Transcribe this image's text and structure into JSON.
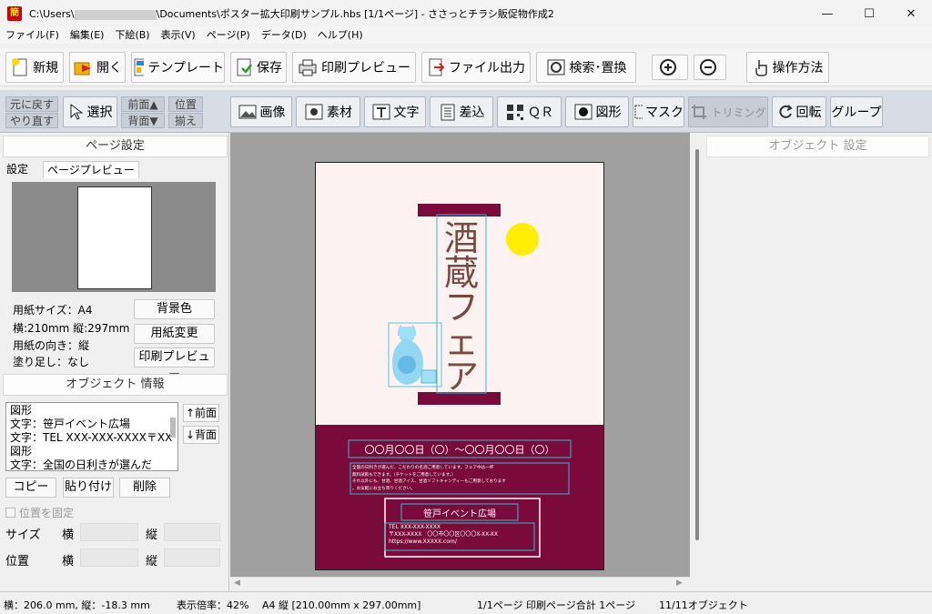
{
  "window": {
    "title_prefix": "C:\\Users\\",
    "title_suffix": "\\Documents\\ポスター拡大印刷サンプル.hbs  [1/1ページ] - ささっとチラシ販促物作成2",
    "app_icon_text": "簡"
  },
  "menu": [
    "ファイル(F)",
    "編集(E)",
    "下絵(B)",
    "表示(V)",
    "ページ(P)",
    "データ(D)",
    "ヘルプ(H)"
  ],
  "toolbar": {
    "new": "新規",
    "open": "開く",
    "template": "テンプレート",
    "save": "保存",
    "print_preview": "印刷プレビュー",
    "file_output": "ファイル出力",
    "search_replace": "検索･置換",
    "how_to": "操作方法"
  },
  "toolbar2": {
    "undo": "元に戻す",
    "redo": "やり直す",
    "select": "選択",
    "front": "前面▲",
    "back": "背面▼",
    "align1": "位置",
    "align2": "揃え",
    "image": "画像",
    "material": "素材",
    "text": "文字",
    "merge": "差込",
    "qr": "ＱＲ",
    "shape": "図形",
    "mask": "マスク",
    "trimming": "トリミング",
    "rotate": "回転",
    "group": "グループ"
  },
  "page_settings": {
    "header": "ページ設定",
    "tab_settings": "設定",
    "tab_preview": "ページプレビュー",
    "paper_size": "用紙サイズ：A4",
    "dimensions": "横:210mm 縦:297mm",
    "orientation": "用紙の向き：縦",
    "bleed": "塗り足し：なし",
    "bg_color_btn": "背景色",
    "paper_change_btn": "用紙変更",
    "print_preview_btn": "印刷プレビュー"
  },
  "object_info": {
    "header": "オブジェクト 情報",
    "items": [
      "図形",
      "文字：笹戸イベント広場",
      "文字：TEL XXX-XXX-XXXX〒XX",
      "図形",
      "文字：全国の日利きが選んだ"
    ],
    "front_btn": "↑前面",
    "back_btn": "↓背面",
    "copy_btn": "コピー",
    "paste_btn": "貼り付け",
    "delete_btn": "削除",
    "lock_label": "位置を固定",
    "size_label": "サイズ",
    "position_label": "位置",
    "width_label": "横",
    "height_label": "縦"
  },
  "object_settings": {
    "header": "オブジェクト 設定"
  },
  "poster": {
    "title_chars": [
      "酒",
      "蔵",
      "フ",
      "ェ",
      "ア"
    ],
    "date_text": "〇〇月〇〇日（〇）〜〇〇月〇〇日（〇）",
    "desc_line1": "全国の日利きが選んだ、こだわりの名酒ご用意しています。フェア中は一杯",
    "desc_line2": "無料試飲もできます。（チケットをご用意しています。）",
    "desc_line3": "それ以外にも、甘酒、甘酒アイス、甘酒ソフトキャンディーもご用意しております",
    "desc_line4": "。お気軽にお立ち寄りください。",
    "venue": "笹戸イベント広場",
    "tel": "TEL XXX-XXX-XXXX",
    "address": "〒XXX-XXXX　〇〇市〇〇区〇〇〇X-XX-XX",
    "url": "https://www.XXXXX.com/",
    "colors": {
      "maroon": "#7a0a3a",
      "bg": "#fdf2f2",
      "moon": "#ffee00",
      "title": "#7a4a42"
    }
  },
  "status": {
    "coords": "横：206.0 mm, 縦：-18.3 mm",
    "zoom": "表示倍率：42%",
    "paper": "A4 縦 [210.00mm x 297.00mm]",
    "pages": "1/1ページ 印刷ページ合計 1ページ",
    "objects": "11/11オブジェクト"
  }
}
